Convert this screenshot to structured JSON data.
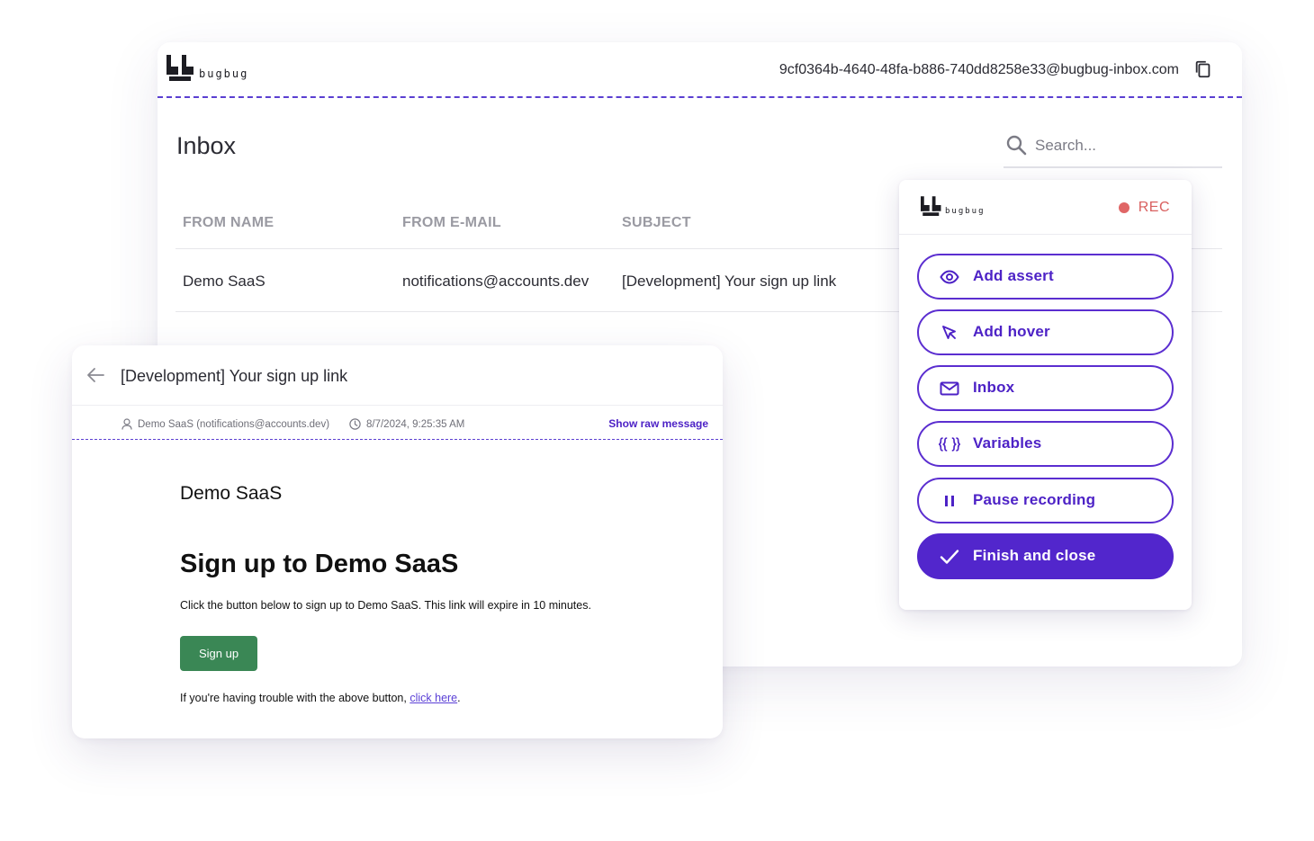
{
  "app": {
    "logo_text": "bugbug"
  },
  "inbox": {
    "email_address": "9cf0364b-4640-48fa-b886-740dd8258e33@bugbug-inbox.com",
    "title": "Inbox",
    "search_placeholder": "Search...",
    "columns": [
      "FROM NAME",
      "FROM E-MAIL",
      "SUBJECT"
    ],
    "rows": [
      {
        "from_name": "Demo SaaS",
        "from_email": "notifications@accounts.dev",
        "subject": "[Development] Your sign up link"
      }
    ]
  },
  "recorder": {
    "status": "REC",
    "status_color": "#e06666",
    "accent_color": "#5226cc",
    "buttons": [
      {
        "label": "Add assert",
        "icon": "eye-icon"
      },
      {
        "label": "Add hover",
        "icon": "cursor-icon"
      },
      {
        "label": "Inbox",
        "icon": "envelope-icon"
      },
      {
        "label": "Variables",
        "icon": "braces-icon"
      },
      {
        "label": "Pause recording",
        "icon": "pause-icon"
      },
      {
        "label": "Finish and close",
        "icon": "check-icon"
      }
    ]
  },
  "message": {
    "subject": "[Development] Your sign up link",
    "from": "Demo SaaS (notifications@accounts.dev)",
    "date": "8/7/2024, 9:25:35 AM",
    "show_raw_label": "Show raw message",
    "body": {
      "brand": "Demo SaaS",
      "heading": "Sign up to Demo SaaS",
      "text": "Click the button below to sign up to Demo SaaS. This link will expire in 10 minutes.",
      "button_label": "Sign up",
      "button_color": "#3a8755",
      "trouble_text": "If you're having trouble with the above button, ",
      "trouble_link": "click here",
      "trouble_end": "."
    }
  }
}
